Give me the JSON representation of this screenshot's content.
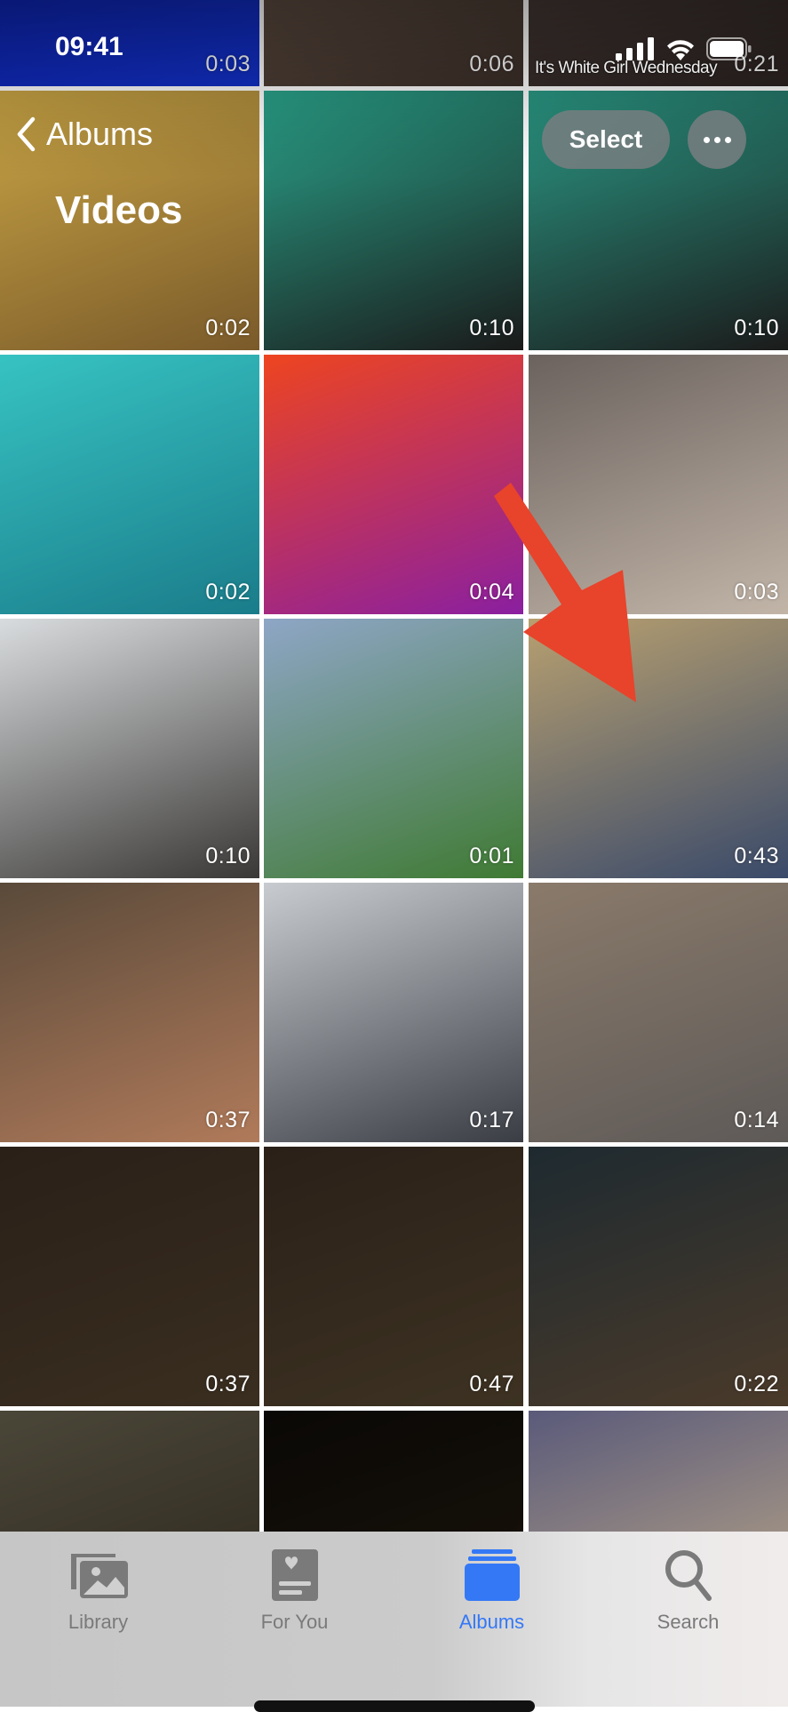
{
  "status_bar": {
    "time": "09:41",
    "icons": [
      "cellular-signal-icon",
      "wifi-icon",
      "battery-icon"
    ]
  },
  "nav": {
    "back_label": "Albums",
    "back_icon": "chevron-left-icon",
    "title": "Videos",
    "select_label": "Select",
    "more_icon": "ellipsis-icon"
  },
  "thumbnail_caption": "It's White Girl Wednesday",
  "videos": [
    {
      "duration": "0:03",
      "colors": [
        "#0a1a9e",
        "#1230c9"
      ]
    },
    {
      "duration": "0:06",
      "colors": [
        "#7a6656",
        "#3b2e28"
      ]
    },
    {
      "duration": "0:21",
      "colors": [
        "#5a4a45",
        "#2a2220"
      ]
    },
    {
      "duration": "0:02",
      "colors": [
        "#c9a545",
        "#7a5a2a"
      ]
    },
    {
      "duration": "0:10",
      "colors": [
        "#2aa58c",
        "#1a1a1a"
      ]
    },
    {
      "duration": "0:10",
      "colors": [
        "#2a9a86",
        "#1b1b1b"
      ]
    },
    {
      "duration": "0:02",
      "colors": [
        "#37c3c2",
        "#1a7c8a"
      ]
    },
    {
      "duration": "0:04",
      "colors": [
        "#ee4520",
        "#8a1fa0"
      ]
    },
    {
      "duration": "0:03",
      "colors": [
        "#6b625e",
        "#c2b5a8"
      ]
    },
    {
      "duration": "0:10",
      "colors": [
        "#d9dcde",
        "#3a3836"
      ]
    },
    {
      "duration": "0:01",
      "colors": [
        "#8ea6c6",
        "#3f7a33"
      ]
    },
    {
      "duration": "0:43",
      "colors": [
        "#b8a070",
        "#3a4a6a"
      ]
    },
    {
      "duration": "0:37",
      "colors": [
        "#5a4a3a",
        "#b07a5a"
      ]
    },
    {
      "duration": "0:17",
      "colors": [
        "#c8ccd0",
        "#3a3d44"
      ]
    },
    {
      "duration": "0:14",
      "colors": [
        "#8a7a6a",
        "#5e5a58"
      ]
    },
    {
      "duration": "0:37",
      "colors": [
        "#2a2018",
        "#3a2e20"
      ]
    },
    {
      "duration": "0:47",
      "colors": [
        "#2a2018",
        "#3d3222"
      ]
    },
    {
      "duration": "0:22",
      "colors": [
        "#1e2a30",
        "#4a3a2a"
      ]
    },
    {
      "duration": "",
      "colors": [
        "#4a4638",
        "#2a241a"
      ]
    },
    {
      "duration": "",
      "colors": [
        "#0a0806",
        "#1a140a"
      ]
    },
    {
      "duration": "",
      "colors": [
        "#5a5a7a",
        "#c6b08a"
      ]
    }
  ],
  "annotation": {
    "type": "arrow",
    "color": "#e8432b",
    "points_to": "0:43 video"
  },
  "tabs": [
    {
      "label": "Library",
      "icon": "photo-library-icon",
      "active": false
    },
    {
      "label": "For You",
      "icon": "for-you-icon",
      "active": false
    },
    {
      "label": "Albums",
      "icon": "albums-icon",
      "active": true
    },
    {
      "label": "Search",
      "icon": "search-icon",
      "active": false
    }
  ],
  "colors": {
    "accent": "#3478f6",
    "inactive": "#7a7a7a"
  }
}
